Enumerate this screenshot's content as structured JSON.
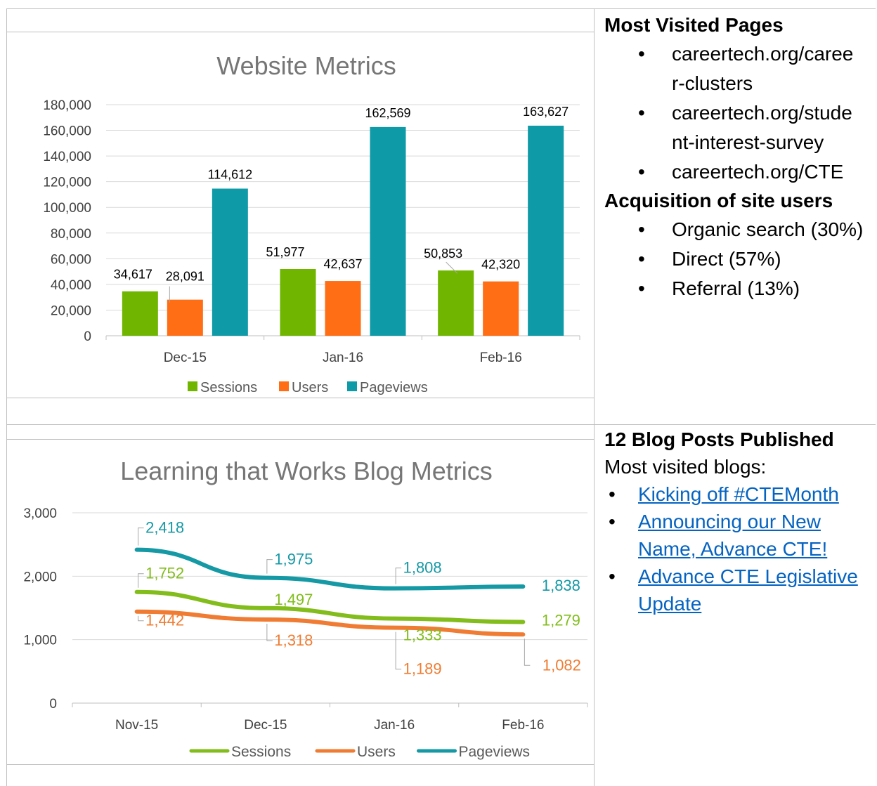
{
  "chart_data": [
    {
      "type": "bar",
      "title": "Website Metrics",
      "categories": [
        "Dec-15",
        "Jan-16",
        "Feb-16"
      ],
      "series": [
        {
          "name": "Sessions",
          "values": [
            34617,
            51977,
            50853
          ],
          "labels": [
            "34,617",
            "51,977",
            "50,853"
          ]
        },
        {
          "name": "Users",
          "values": [
            28091,
            42637,
            42320
          ],
          "labels": [
            "28,091",
            "42,637",
            "42,320"
          ]
        },
        {
          "name": "Pageviews",
          "values": [
            114612,
            162569,
            163627
          ],
          "labels": [
            "114,612",
            "162,569",
            "163,627"
          ]
        }
      ],
      "ylim": [
        0,
        180000
      ],
      "yticks": [
        "0",
        "20,000",
        "40,000",
        "60,000",
        "80,000",
        "100,000",
        "120,000",
        "140,000",
        "160,000",
        "180,000"
      ],
      "grid": true,
      "legend": "bottom"
    },
    {
      "type": "line",
      "title": "Learning that Works Blog Metrics",
      "categories": [
        "Nov-15",
        "Dec-15",
        "Jan-16",
        "Feb-16"
      ],
      "series": [
        {
          "name": "Sessions",
          "values": [
            1752,
            1497,
            1333,
            1279
          ],
          "labels": [
            "1,752",
            "1,497",
            "1,333",
            "1,279"
          ]
        },
        {
          "name": "Users",
          "values": [
            1442,
            1318,
            1189,
            1082
          ],
          "labels": [
            "1,442",
            "1,318",
            "1,189",
            "1,082"
          ]
        },
        {
          "name": "Pageviews",
          "values": [
            2418,
            1975,
            1808,
            1838
          ],
          "labels": [
            "2,418",
            "1,975",
            "1,808",
            "1,838"
          ]
        }
      ],
      "ylim": [
        0,
        3000
      ],
      "yticks": [
        "0",
        "1,000",
        "2,000",
        "3,000"
      ],
      "grid": true,
      "legend": "bottom"
    }
  ],
  "colors": {
    "bar_sessions": "#70b600",
    "bar_users": "#ff6d14",
    "bar_pageviews": "#0e9aa7",
    "line_sessions": "#82bd1c",
    "line_users": "#ef7c32",
    "line_pageviews": "#1499a5",
    "title_gray": "#767676",
    "link_blue": "#0563c1"
  },
  "panel1": {
    "heading_pages": "Most Visited Pages",
    "pages": [
      "careertech.org/caree",
      "r-clusters",
      "careertech.org/stude",
      "nt-interest-survey",
      "careertech.org/CTE"
    ],
    "heading_acquisition": "Acquisition of site users",
    "acquisition": [
      "Organic search (30%)",
      "Direct (57%)",
      "Referral (13%)"
    ]
  },
  "panel2": {
    "heading": "12 Blog Posts Published",
    "subheading": "Most visited blogs:",
    "blogs": [
      "Kicking off #CTEMonth",
      "Announcing our New",
      "Name, Advance CTE!",
      "Advance CTE Legislative",
      "Update"
    ]
  }
}
